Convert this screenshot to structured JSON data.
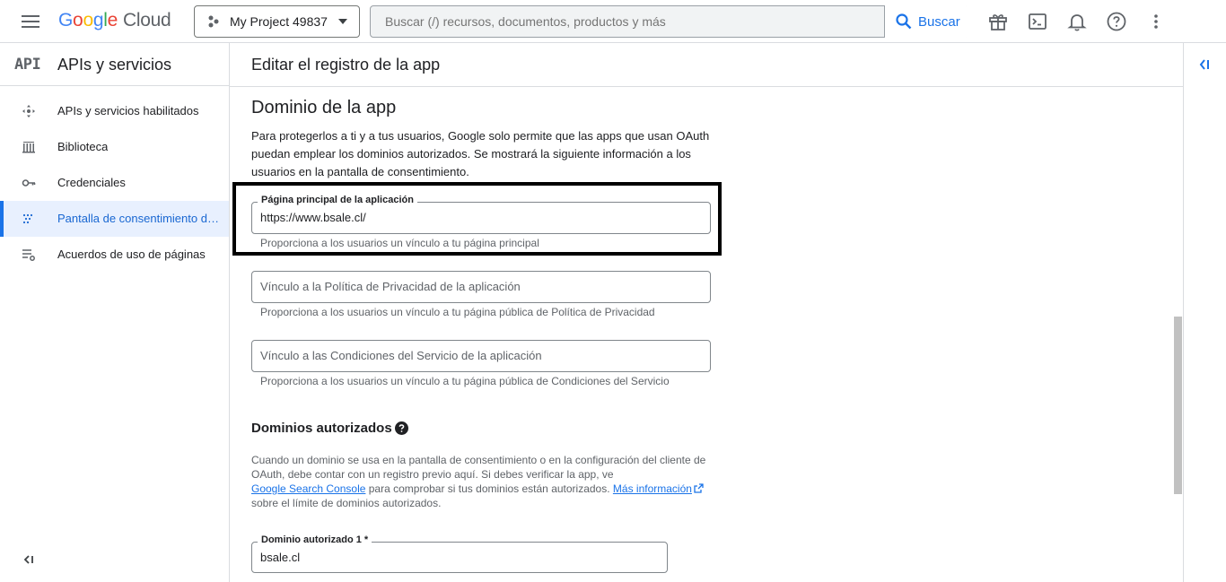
{
  "topbar": {
    "logo": {
      "g1": "G",
      "g2": "o",
      "g3": "o",
      "g4": "g",
      "g5": "l",
      "g6": "e",
      "product": "Cloud"
    },
    "project_name": "My Project 49837",
    "search_placeholder": "Buscar (/) recursos, documentos, productos y más",
    "search_button": "Buscar",
    "icons": [
      "menu-icon",
      "gift-icon",
      "terminal-icon",
      "bell-icon",
      "help-icon",
      "more-vert-icon"
    ]
  },
  "sidebar": {
    "badge": "API",
    "title": "APIs y servicios",
    "items": [
      {
        "label": "APIs y servicios habilitados",
        "icon": "apis-icon"
      },
      {
        "label": "Biblioteca",
        "icon": "library-icon"
      },
      {
        "label": "Credenciales",
        "icon": "key-icon"
      },
      {
        "label": "Pantalla de consentimiento de OAuth",
        "icon": "consent-icon",
        "active": true
      },
      {
        "label": "Acuerdos de uso de páginas",
        "icon": "agreements-icon"
      }
    ]
  },
  "main": {
    "header": "Editar el registro de la app",
    "section_title": "Dominio de la app",
    "section_desc": "Para protegerlos a ti y a tus usuarios, Google solo permite que las apps que usan OAuth puedan emplear los dominios autorizados. Se mostrará la siguiente información a los usuarios en la pantalla de consentimiento.",
    "homepage": {
      "label": "Página principal de la aplicación",
      "value": "https://www.bsale.cl/",
      "hint": "Proporciona a los usuarios un vínculo a tu página principal"
    },
    "privacy": {
      "placeholder": "Vínculo a la Política de Privacidad de la aplicación",
      "hint": "Proporciona a los usuarios un vínculo a tu página pública de Política de Privacidad"
    },
    "terms": {
      "placeholder": "Vínculo a las Condiciones del Servicio de la aplicación",
      "hint": "Proporciona a los usuarios un vínculo a tu página pública de Condiciones del Servicio"
    },
    "authorized": {
      "title": "Dominios autorizados",
      "desc_1": "Cuando un dominio se usa en la pantalla de consentimiento o en la configuración del cliente de OAuth, debe contar con un registro previo aquí. Si debes verificar la app, ve",
      "link_console": "Google Search Console",
      "desc_2": " para comprobar si tus dominios están autorizados. ",
      "link_more": "Más información",
      "desc_3": "sobre el límite de dominios autorizados.",
      "domain_label": "Dominio autorizado 1 *",
      "domain_value": "bsale.cl"
    }
  },
  "colors": {
    "accent": "#1a73e8",
    "active_bg": "#e8f0fe",
    "border": "#dadce0",
    "text": "#202124",
    "muted": "#5f6368"
  }
}
